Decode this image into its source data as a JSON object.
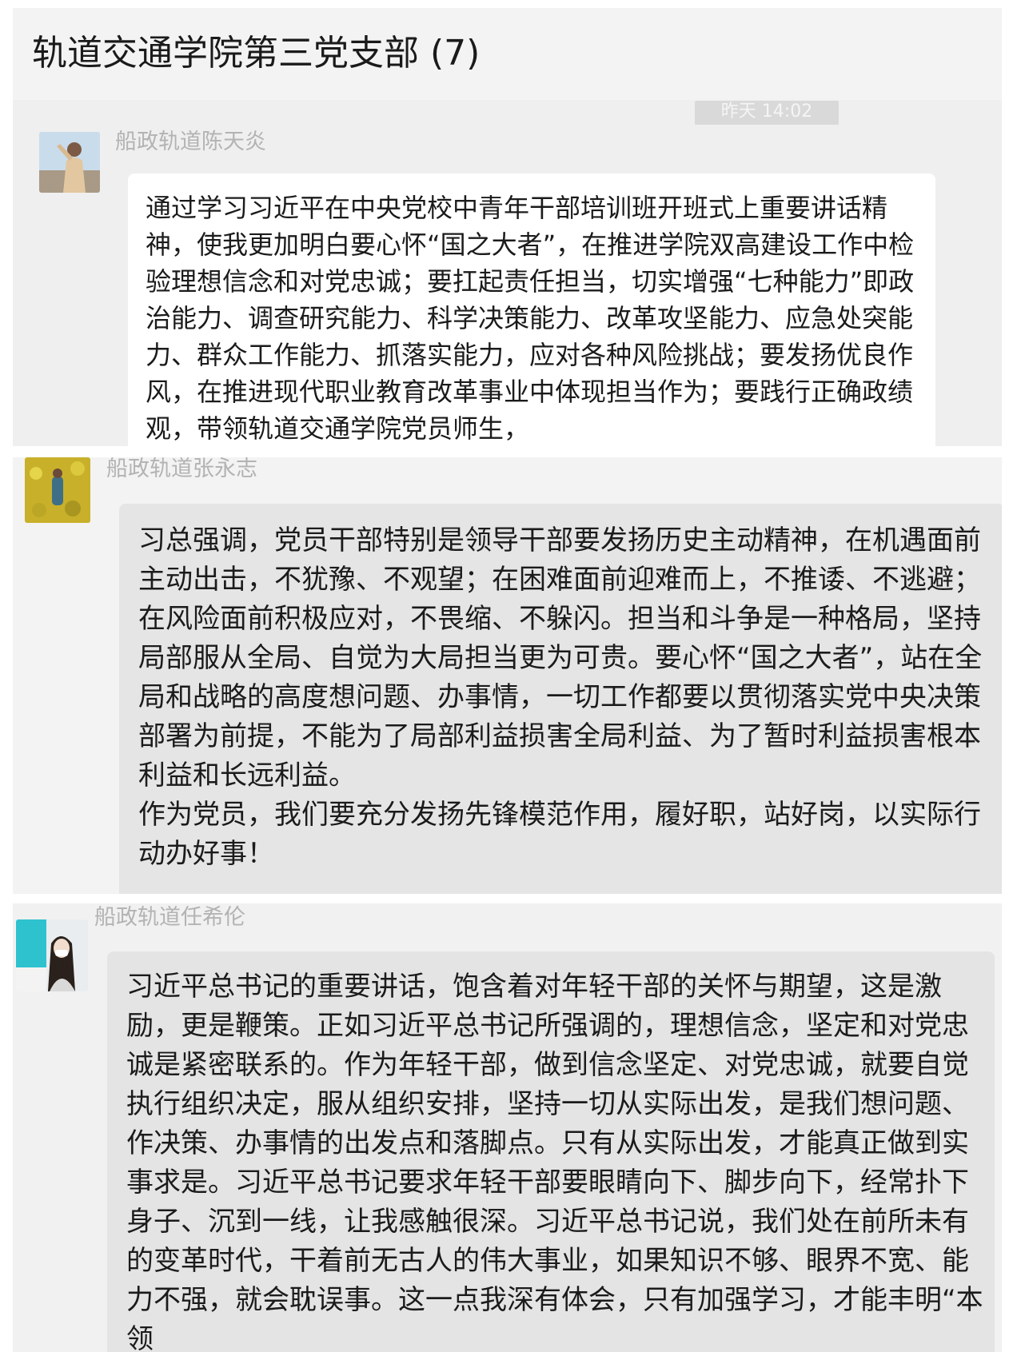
{
  "chat": {
    "title": "轨道交通学院第三党支部 (7)",
    "time_chip": "昨天 14:02"
  },
  "messages": [
    {
      "sender": "船政轨道陈天炎",
      "text": "通过学习习近平在中央党校中青年干部培训班开班式上重要讲话精神，使我更加明白要心怀“国之大者”，在推进学院双高建设工作中检验理想信念和对党忠诚；要扛起责任担当，切实增强“七种能力”即政治能力、调查研究能力、科学决策能力、改革攻坚能力、应急处突能力、群众工作能力、抓落实能力，应对各种风险挑战；要发扬优良作风，在推进现代职业教育改革事业中体现担当作为；要践行正确政绩观，带领轨道交通学院党员师生，"
    },
    {
      "sender": "船政轨道张永志",
      "text": "习总强调，党员干部特别是领导干部要发扬历史主动精神，在机遇面前主动出击，不犹豫、不观望；在困难面前迎难而上，不推诿、不逃避；在风险面前积极应对，不畏缩、不躲闪。担当和斗争是一种格局，坚持局部服从全局、自觉为大局担当更为可贵。要心怀“国之大者”，站在全局和战略的高度想问题、办事情，一切工作都要以贯彻落实党中央决策部署为前提，不能为了局部利益损害全局利益、为了暂时利益损害根本利益和长远利益。\n作为党员，我们要充分发扬先锋模范作用，履好职，站好岗，以实际行动办好事！"
    },
    {
      "sender": "船政轨道任希伦",
      "text": "习近平总书记的重要讲话，饱含着对年轻干部的关怀与期望，这是激励，更是鞭策。正如习近平总书记所强调的，理想信念，坚定和对党忠诚是紧密联系的。作为年轻干部，做到信念坚定、对党忠诚，就要自觉执行组织决定，服从组织安排，坚持一切从实际出发，是我们想问题、作决策、办事情的出发点和落脚点。只有从实际出发，才能真正做到实事求是。习近平总书记要求年轻干部要眼睛向下、脚步向下，经常扑下身子、沉到一线，让我感触很深。习近平总书记说，我们处在前所未有的变革时代，干着前无古人的伟大事业，如果知识不够、眼界不宽、能力不强，就会耽误事。这一点我深有体会，只有加强学习，才能丰明“本领"
    }
  ]
}
